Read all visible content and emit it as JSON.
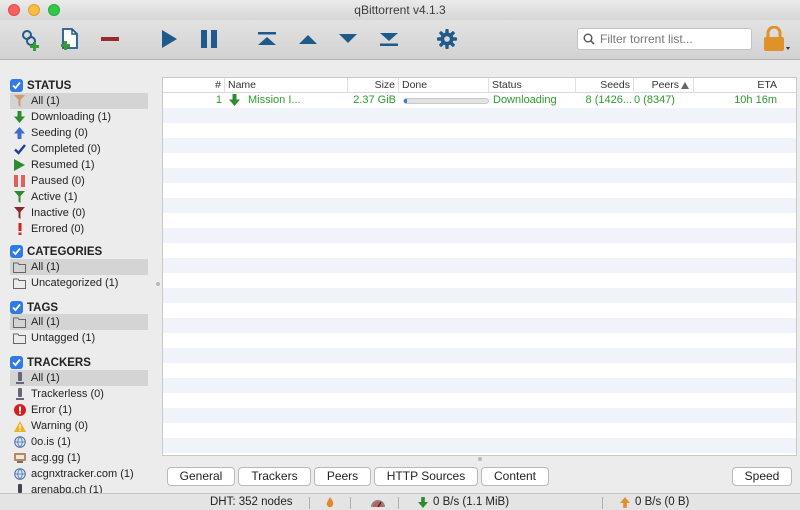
{
  "window": {
    "title": "qBittorrent v4.1.3"
  },
  "toolbar": {
    "buttons": [
      {
        "name": "add-torrent-link",
        "icon": "add-link-icon"
      },
      {
        "name": "add-torrent-file",
        "icon": "add-file-icon"
      },
      {
        "name": "delete",
        "icon": "minus-icon"
      },
      {
        "name": "resume",
        "icon": "play-icon"
      },
      {
        "name": "pause",
        "icon": "pause-icon"
      },
      {
        "name": "move-top",
        "icon": "move-top-icon"
      },
      {
        "name": "move-up",
        "icon": "move-up-icon"
      },
      {
        "name": "move-down",
        "icon": "move-down-icon"
      },
      {
        "name": "move-bottom",
        "icon": "move-bottom-icon"
      },
      {
        "name": "options",
        "icon": "gear-icon"
      },
      {
        "name": "lock",
        "icon": "lock-icon"
      }
    ],
    "search_placeholder": "Filter torrent list..."
  },
  "sidebar": {
    "status": {
      "heading": "STATUS",
      "items": [
        {
          "label": "All (1)",
          "icon": "filter-icon",
          "selected": true
        },
        {
          "label": "Downloading (1)",
          "icon": "download-arrow-icon"
        },
        {
          "label": "Seeding (0)",
          "icon": "upload-arrow-icon"
        },
        {
          "label": "Completed (0)",
          "icon": "checkmark-icon"
        },
        {
          "label": "Resumed (1)",
          "icon": "play-icon"
        },
        {
          "label": "Paused (0)",
          "icon": "pause-icon"
        },
        {
          "label": "Active (1)",
          "icon": "filter-green-icon"
        },
        {
          "label": "Inactive (0)",
          "icon": "filter-red-icon"
        },
        {
          "label": "Errored (0)",
          "icon": "exclamation-icon"
        }
      ]
    },
    "categories": {
      "heading": "CATEGORIES",
      "items": [
        {
          "label": "All (1)",
          "icon": "folder-icon",
          "selected": true
        },
        {
          "label": "Uncategorized (1)",
          "icon": "folder-icon"
        }
      ]
    },
    "tags": {
      "heading": "TAGS",
      "items": [
        {
          "label": "All (1)",
          "icon": "folder-icon",
          "selected": true
        },
        {
          "label": "Untagged (1)",
          "icon": "folder-icon"
        }
      ]
    },
    "trackers": {
      "heading": "TRACKERS",
      "items": [
        {
          "label": "All (1)",
          "icon": "tracker-icon",
          "selected": true
        },
        {
          "label": "Trackerless (0)",
          "icon": "tracker-icon"
        },
        {
          "label": "Error (1)",
          "icon": "error-icon"
        },
        {
          "label": "Warning (0)",
          "icon": "warning-icon"
        },
        {
          "label": "0o.is (1)",
          "icon": "globe-icon"
        },
        {
          "label": "acg.gg (1)",
          "icon": "site-favicon-icon"
        },
        {
          "label": "acgnxtracker.com (1)",
          "icon": "globe-icon"
        },
        {
          "label": "arenabg.ch (1)",
          "icon": "tracker-icon"
        }
      ]
    }
  },
  "table": {
    "columns": [
      "#",
      "Name",
      "Size",
      "Done",
      "Status",
      "Seeds",
      "Peers",
      "ETA"
    ],
    "sort_column": "Peers",
    "rows": [
      {
        "num": "1",
        "name": "Mission I...",
        "size": "2.37 GiB",
        "done_progress": 0.04,
        "status": "Downloading",
        "seeds": "8 (1426...",
        "peers": "0 (8347)",
        "eta": "10h 16m"
      }
    ]
  },
  "tabs": {
    "general": "General",
    "trackers": "Trackers",
    "peers": "Peers",
    "http_sources": "HTTP Sources",
    "content": "Content",
    "speed": "Speed"
  },
  "statusbar": {
    "dht": "DHT: 352 nodes",
    "download": "0 B/s (1.1 MiB)",
    "upload": "0 B/s (0 B)"
  },
  "colors": {
    "accent": "#2f7ae5",
    "toolbar_icon": "#1e5a8c",
    "downloading_text": "#2e9a2e",
    "delete_red": "#9b2a2a",
    "lock": "#e0922a"
  }
}
